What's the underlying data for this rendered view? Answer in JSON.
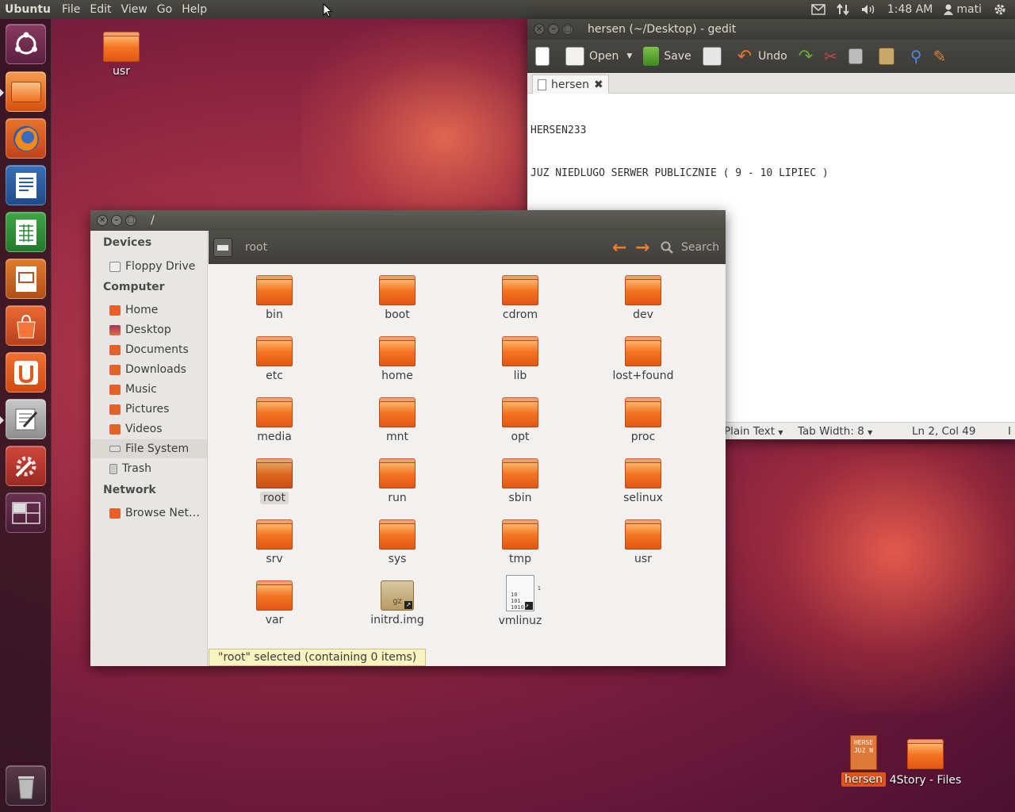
{
  "top_panel": {
    "brand": "Ubuntu",
    "menu": [
      "File",
      "Edit",
      "View",
      "Go",
      "Help"
    ],
    "clock": "1:48 AM",
    "user": "mati"
  },
  "launcher": {
    "items": [
      "dash-home",
      "files",
      "firefox",
      "libreoffice-writer",
      "libreoffice-calc",
      "libreoffice-impress",
      "software-center",
      "ubuntu-one",
      "text-editor",
      "system-settings",
      "workspace-switcher",
      "trash"
    ]
  },
  "desktop": {
    "usr_label": "usr",
    "hersen_label": "hersen",
    "hersen_thumb_line1": "HERSE",
    "hersen_thumb_line2": "JUZ N",
    "story_label": "4Story - Files"
  },
  "gedit": {
    "title": "hersen (~/Desktop) - gedit",
    "toolbar": {
      "open": "Open",
      "save": "Save",
      "undo": "Undo"
    },
    "tab_label": "hersen",
    "text_line1": "HERSEN233",
    "text_line2": "JUZ NIEDLUGO SERWER PUBLICZNIE ( 9 - 10 LIPIEC )",
    "status": {
      "mode": "Plain Text",
      "tab_width": "Tab Width: 8",
      "position": "Ln 2, Col 49",
      "ins": "I"
    }
  },
  "nautilus": {
    "title": "/",
    "location": "root",
    "search": "Search",
    "sidebar": {
      "devices_header": "Devices",
      "floppy": "Floppy Drive",
      "computer_header": "Computer",
      "home": "Home",
      "desktop": "Desktop",
      "documents": "Documents",
      "downloads": "Downloads",
      "music": "Music",
      "pictures": "Pictures",
      "videos": "Videos",
      "filesystem": "File System",
      "trash": "Trash",
      "network_header": "Network",
      "browse": "Browse Net…"
    },
    "files": [
      "bin",
      "boot",
      "cdrom",
      "dev",
      "etc",
      "home",
      "lib",
      "lost+found",
      "media",
      "mnt",
      "opt",
      "proc",
      "root",
      "run",
      "sbin",
      "selinux",
      "srv",
      "sys",
      "tmp",
      "usr",
      "var",
      "initrd.img",
      "vmlinuz"
    ],
    "vmlinuz_glyph": "1\n10\n101\n1010",
    "initrd_glyph": "gz",
    "status": "\"root\" selected (containing 0 items)"
  }
}
